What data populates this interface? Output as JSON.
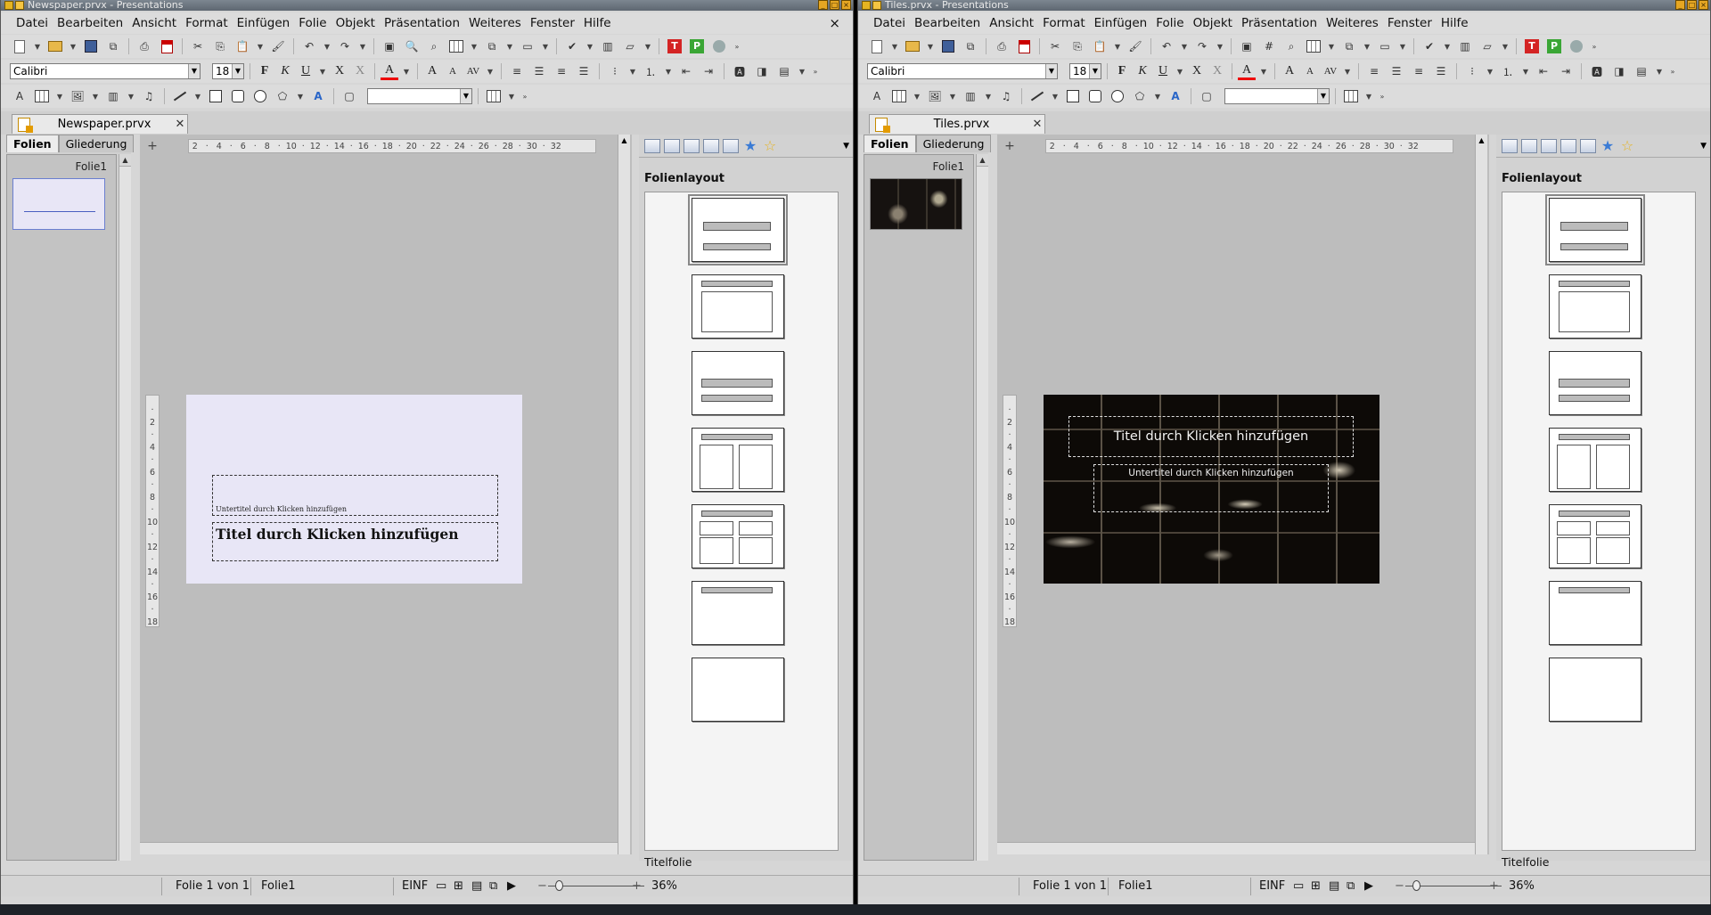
{
  "menu": [
    "Datei",
    "Bearbeiten",
    "Ansicht",
    "Format",
    "Einfügen",
    "Folie",
    "Objekt",
    "Präsentation",
    "Weiteres",
    "Fenster",
    "Hilfe"
  ],
  "menu_close": "×",
  "format_bar": {
    "font": "Calibri",
    "size": "18",
    "bold": "F",
    "italic": "K",
    "underline": "U",
    "strike": "X",
    "shadow": "X",
    "color": "A",
    "grow": "A",
    "shrink": "A",
    "spacing": "AV"
  },
  "slides_tabs": [
    "Folien",
    "Gliederung"
  ],
  "panel": {
    "title": "Folienlayout",
    "status": "Titelfolie"
  },
  "ruler_h": [
    "2",
    "",
    "4",
    "",
    "6",
    "",
    "8",
    "",
    "10",
    "",
    "12",
    "",
    "14",
    "",
    "16",
    "",
    "18",
    "",
    "20",
    "",
    "22",
    "",
    "24",
    "",
    "26",
    "",
    "28",
    "",
    "30",
    "",
    "32"
  ],
  "ruler_v": [
    "",
    "2",
    "",
    "4",
    "",
    "6",
    "",
    "8",
    "",
    "10",
    "",
    "12",
    "",
    "14",
    "",
    "16",
    "",
    "18"
  ],
  "windows": {
    "left": {
      "title": "Newspaper.prvx - Presentations",
      "tab": "Newspaper.prvx",
      "slide_name": "Folie1",
      "subtitle_placeholder": "Untertitel durch Klicken hinzufügen",
      "title_placeholder": "Titel durch Klicken hinzufügen",
      "status_slide": "Folie 1 von 1",
      "status_name": "Folie1",
      "status_mode": "EINF",
      "zoom": "36%",
      "slide_bg": "#e8e6f6"
    },
    "right": {
      "title": "Tiles.prvx - Presentations",
      "tab": "Tiles.prvx",
      "slide_name": "Folie1",
      "title_placeholder": "Titel durch Klicken hinzufügen",
      "subtitle_placeholder": "Untertitel durch Klicken hinzufügen",
      "status_slide": "Folie 1 von 1",
      "status_name": "Folie1",
      "status_mode": "EINF",
      "zoom": "36%",
      "slide_bg": "#0d0a07"
    }
  }
}
